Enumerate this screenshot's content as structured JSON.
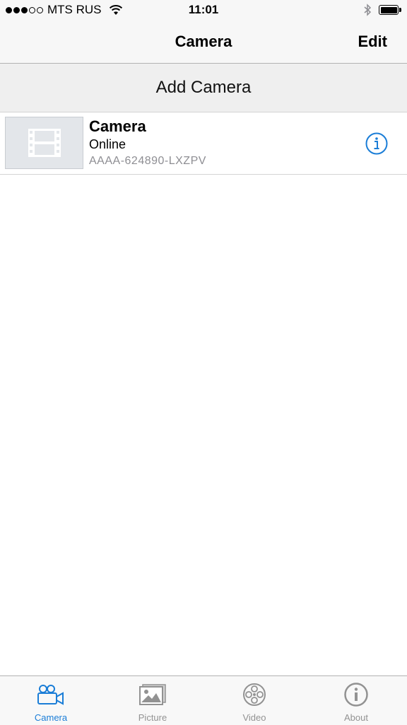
{
  "status_bar": {
    "carrier": "MTS RUS",
    "time": "11:01",
    "signal_bars_filled": 3,
    "signal_bars_total": 5,
    "battery_level": 1.0
  },
  "nav": {
    "title": "Camera",
    "edit_label": "Edit"
  },
  "add_camera": {
    "label": "Add Camera"
  },
  "cameras": [
    {
      "name": "Camera",
      "status": "Online",
      "id": "AAAA-624890-LXZPV",
      "thumbnail_icon": "film-icon",
      "info_icon": "info-icon"
    }
  ],
  "tabs": [
    {
      "label": "Camera",
      "icon": "video-camera-icon",
      "active": true
    },
    {
      "label": "Picture",
      "icon": "picture-icon",
      "active": false
    },
    {
      "label": "Video",
      "icon": "film-reel-icon",
      "active": false
    },
    {
      "label": "About",
      "icon": "info-icon",
      "active": false
    }
  ],
  "colors": {
    "accent": "#1a7dd7",
    "tab_inactive": "#929292",
    "secondary_text": "#8e8e93"
  }
}
